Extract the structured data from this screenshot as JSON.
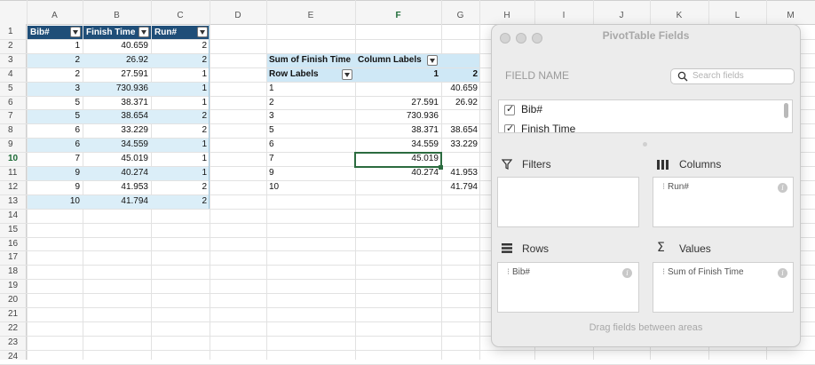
{
  "columns": [
    "A",
    "B",
    "C",
    "D",
    "E",
    "F",
    "G",
    "H",
    "I",
    "J",
    "K",
    "L",
    "M"
  ],
  "rows": [
    "1",
    "2",
    "3",
    "4",
    "5",
    "6",
    "7",
    "8",
    "9",
    "10",
    "11",
    "12",
    "13",
    "14",
    "15",
    "16",
    "17",
    "18",
    "19",
    "20",
    "21",
    "22",
    "23",
    "24"
  ],
  "table": {
    "headers": [
      "Bib#",
      "Finish Time",
      "Run#"
    ],
    "data": [
      [
        "1",
        "40.659",
        "2"
      ],
      [
        "2",
        "26.92",
        "2"
      ],
      [
        "2",
        "27.591",
        "1"
      ],
      [
        "3",
        "730.936",
        "1"
      ],
      [
        "5",
        "38.371",
        "1"
      ],
      [
        "5",
        "38.654",
        "2"
      ],
      [
        "6",
        "33.229",
        "2"
      ],
      [
        "6",
        "34.559",
        "1"
      ],
      [
        "7",
        "45.019",
        "1"
      ],
      [
        "9",
        "40.274",
        "1"
      ],
      [
        "9",
        "41.953",
        "2"
      ],
      [
        "10",
        "41.794",
        "2"
      ]
    ]
  },
  "pivot": {
    "values_label": "Sum of Finish Time",
    "column_labels": "Column Labels",
    "row_labels": "Row Labels",
    "col_keys": [
      "1",
      "2"
    ],
    "rows": [
      [
        "1",
        "",
        "40.659"
      ],
      [
        "2",
        "27.591",
        "26.92"
      ],
      [
        "3",
        "730.936",
        ""
      ],
      [
        "5",
        "38.371",
        "38.654"
      ],
      [
        "6",
        "34.559",
        "33.229"
      ],
      [
        "7",
        "45.019",
        ""
      ],
      [
        "9",
        "40.274",
        "41.953"
      ],
      [
        "10",
        "",
        "41.794"
      ]
    ]
  },
  "panel": {
    "title": "PivotTable Fields",
    "field_name_label": "FIELD NAME",
    "search_placeholder": "Search fields",
    "fields": [
      "Bib#",
      "Finish Time"
    ],
    "filters_label": "Filters",
    "columns_label": "Columns",
    "rows_label": "Rows",
    "values_label": "Values",
    "columns_field": "Run#",
    "rows_field": "Bib#",
    "values_field": "Sum of Finish Time",
    "drag_hint": "Drag fields between areas"
  },
  "icons": [
    "filter-icon",
    "columns-icon",
    "rows-icon",
    "sigma-icon",
    "search-icon",
    "info-icon",
    "checkbox-icon"
  ],
  "colors": {
    "header_blue": "#1f4e78",
    "band_blue": "#dbeef8",
    "pivot_head": "#cfe8f6",
    "select_green": "#2b6b3f"
  }
}
